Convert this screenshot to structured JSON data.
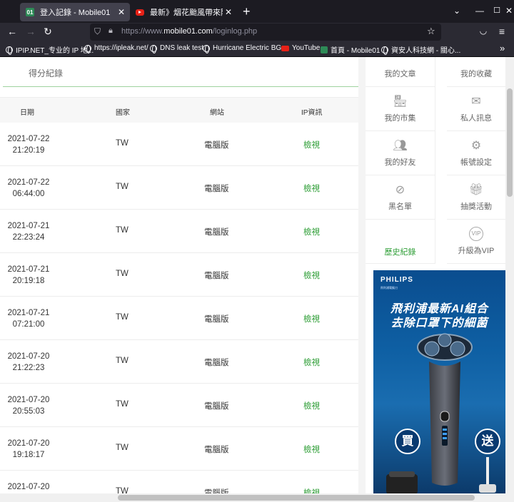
{
  "browser": {
    "tabs": [
      {
        "title": "登入記錄 - Mobile01",
        "active": true
      },
      {
        "title": "最新》烟花颱風帶來降雨 汐止",
        "active": false
      }
    ],
    "url": {
      "prefix": "https://www.",
      "domain": "mobile01.com",
      "path": "/loginlog.php"
    },
    "bookmarks": [
      "IPIP.NET_专业的 IP 地...",
      "https://ipleak.net/",
      "DNS leak test",
      "Hurricane Electric BG...",
      "YouTube",
      "首頁 - Mobile01",
      "資安人科技網 - 關心..."
    ],
    "bookmarks_more": "»"
  },
  "main": {
    "section_title": "得分紀錄",
    "columns": [
      "日期",
      "國家",
      "網站",
      "IP資訊"
    ],
    "rows": [
      {
        "date": "2021-07-22",
        "time": "21:20:19",
        "country": "TW",
        "site": "電腦版",
        "ip": "檢視"
      },
      {
        "date": "2021-07-22",
        "time": "06:44:00",
        "country": "TW",
        "site": "電腦版",
        "ip": "檢視"
      },
      {
        "date": "2021-07-21",
        "time": "22:23:24",
        "country": "TW",
        "site": "電腦版",
        "ip": "檢視"
      },
      {
        "date": "2021-07-21",
        "time": "20:19:18",
        "country": "TW",
        "site": "電腦版",
        "ip": "檢視"
      },
      {
        "date": "2021-07-21",
        "time": "07:21:00",
        "country": "TW",
        "site": "電腦版",
        "ip": "檢視"
      },
      {
        "date": "2021-07-20",
        "time": "21:22:23",
        "country": "TW",
        "site": "電腦版",
        "ip": "檢視"
      },
      {
        "date": "2021-07-20",
        "time": "20:55:03",
        "country": "TW",
        "site": "電腦版",
        "ip": "檢視"
      },
      {
        "date": "2021-07-20",
        "time": "19:18:17",
        "country": "TW",
        "site": "電腦版",
        "ip": "檢視"
      },
      {
        "date": "2021-07-20",
        "time": "",
        "country": "TW",
        "site": "電腦版",
        "ip": "檢視"
      }
    ]
  },
  "sidebar": {
    "items": [
      {
        "label": "我的文章",
        "icon": "article-icon"
      },
      {
        "label": "我的收藏",
        "icon": "bookmark-icon"
      },
      {
        "label": "我的市集",
        "icon": "store-icon"
      },
      {
        "label": "私人訊息",
        "icon": "mail-icon"
      },
      {
        "label": "我的好友",
        "icon": "friends-icon"
      },
      {
        "label": "帳號設定",
        "icon": "gear-icon"
      },
      {
        "label": "黑名單",
        "icon": "block-icon"
      },
      {
        "label": "抽獎活動",
        "icon": "gift-icon"
      },
      {
        "label": "歷史紀錄",
        "icon": "",
        "accent": "#2e9e36"
      },
      {
        "label": "升級為VIP",
        "icon": "vip-icon",
        "icon_text": "VIP"
      }
    ],
    "ad": {
      "brand": "PHILIPS",
      "sub": "飛利浦電鬍刀",
      "headline1": "飛利浦最新AI組合",
      "headline2": "去除口罩下的細菌",
      "left_badge": "買",
      "right_badge": "送"
    }
  }
}
